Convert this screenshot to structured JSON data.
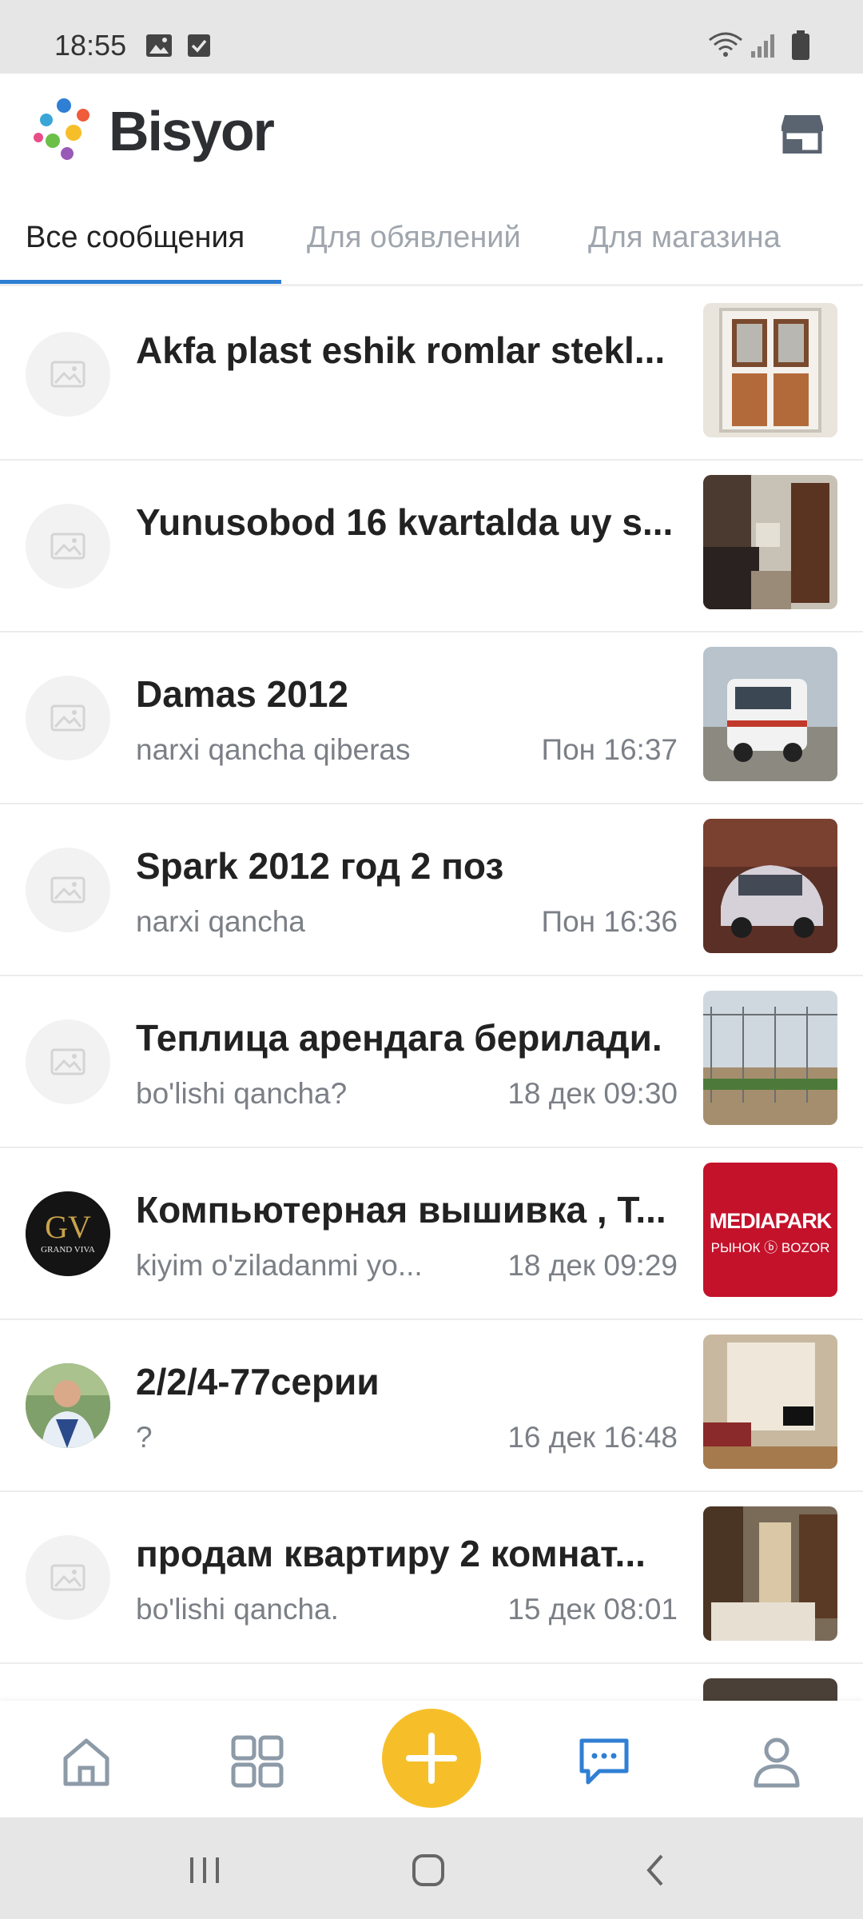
{
  "status_bar": {
    "time": "18:55"
  },
  "app": {
    "brand": "Bisyor"
  },
  "tabs": [
    {
      "label": "Все сообщения",
      "active": true
    },
    {
      "label": "Для обявлений",
      "active": false
    },
    {
      "label": "Для магазина",
      "active": false
    }
  ],
  "conversations": [
    {
      "title": "Akfa plast eshik romlar stekl...",
      "preview": "",
      "time": "",
      "avatar": "placeholder-icon",
      "thumb": "door-photo"
    },
    {
      "title": "Yunusobod 16 kvartalda uy s...",
      "preview": "",
      "time": "",
      "avatar": "placeholder-icon",
      "thumb": "kitchen-photo"
    },
    {
      "title": "Damas 2012",
      "preview": "narxi qancha qiberas",
      "time": "Пон 16:37",
      "avatar": "placeholder-icon",
      "thumb": "van-photo"
    },
    {
      "title": "Spark 2012 год 2 поз",
      "preview": "narxi qancha",
      "time": "Пон 16:36",
      "avatar": "placeholder-icon",
      "thumb": "car-photo"
    },
    {
      "title": "Теплица арендага берилади.",
      "preview": "bo'lishi qancha?",
      "time": "18 дек 09:30",
      "avatar": "placeholder-icon",
      "thumb": "greenhouse-photo"
    },
    {
      "title": "Компьютерная вышивка , Т...",
      "preview": "kiyim o'ziladanmi yo...",
      "time": "18 дек 09:29",
      "avatar": "gv-logo",
      "thumb": "mediapark-photo",
      "thumb_text_1": "MEDIAPARK",
      "thumb_text_2": "РЫНОК ⓑ BOZOR"
    },
    {
      "title": "2/2/4-77серии",
      "preview": "?",
      "time": "16 дек 16:48",
      "avatar": "user-photo",
      "thumb": "room-photo"
    },
    {
      "title": "продам квартиру  2 комнат...",
      "preview": "bo'lishi qancha.",
      "time": "15 дек 08:01",
      "avatar": "placeholder-icon",
      "thumb": "bedroom-photo"
    }
  ],
  "colors": {
    "accent": "#2f7fd4",
    "fab": "#f6bf2a",
    "nav_icon": "#8d9aa8",
    "nav_active": "#2f7fd4"
  },
  "bottom_nav": [
    "home-icon",
    "grid-icon",
    "add-icon",
    "messages-icon",
    "profile-icon"
  ]
}
